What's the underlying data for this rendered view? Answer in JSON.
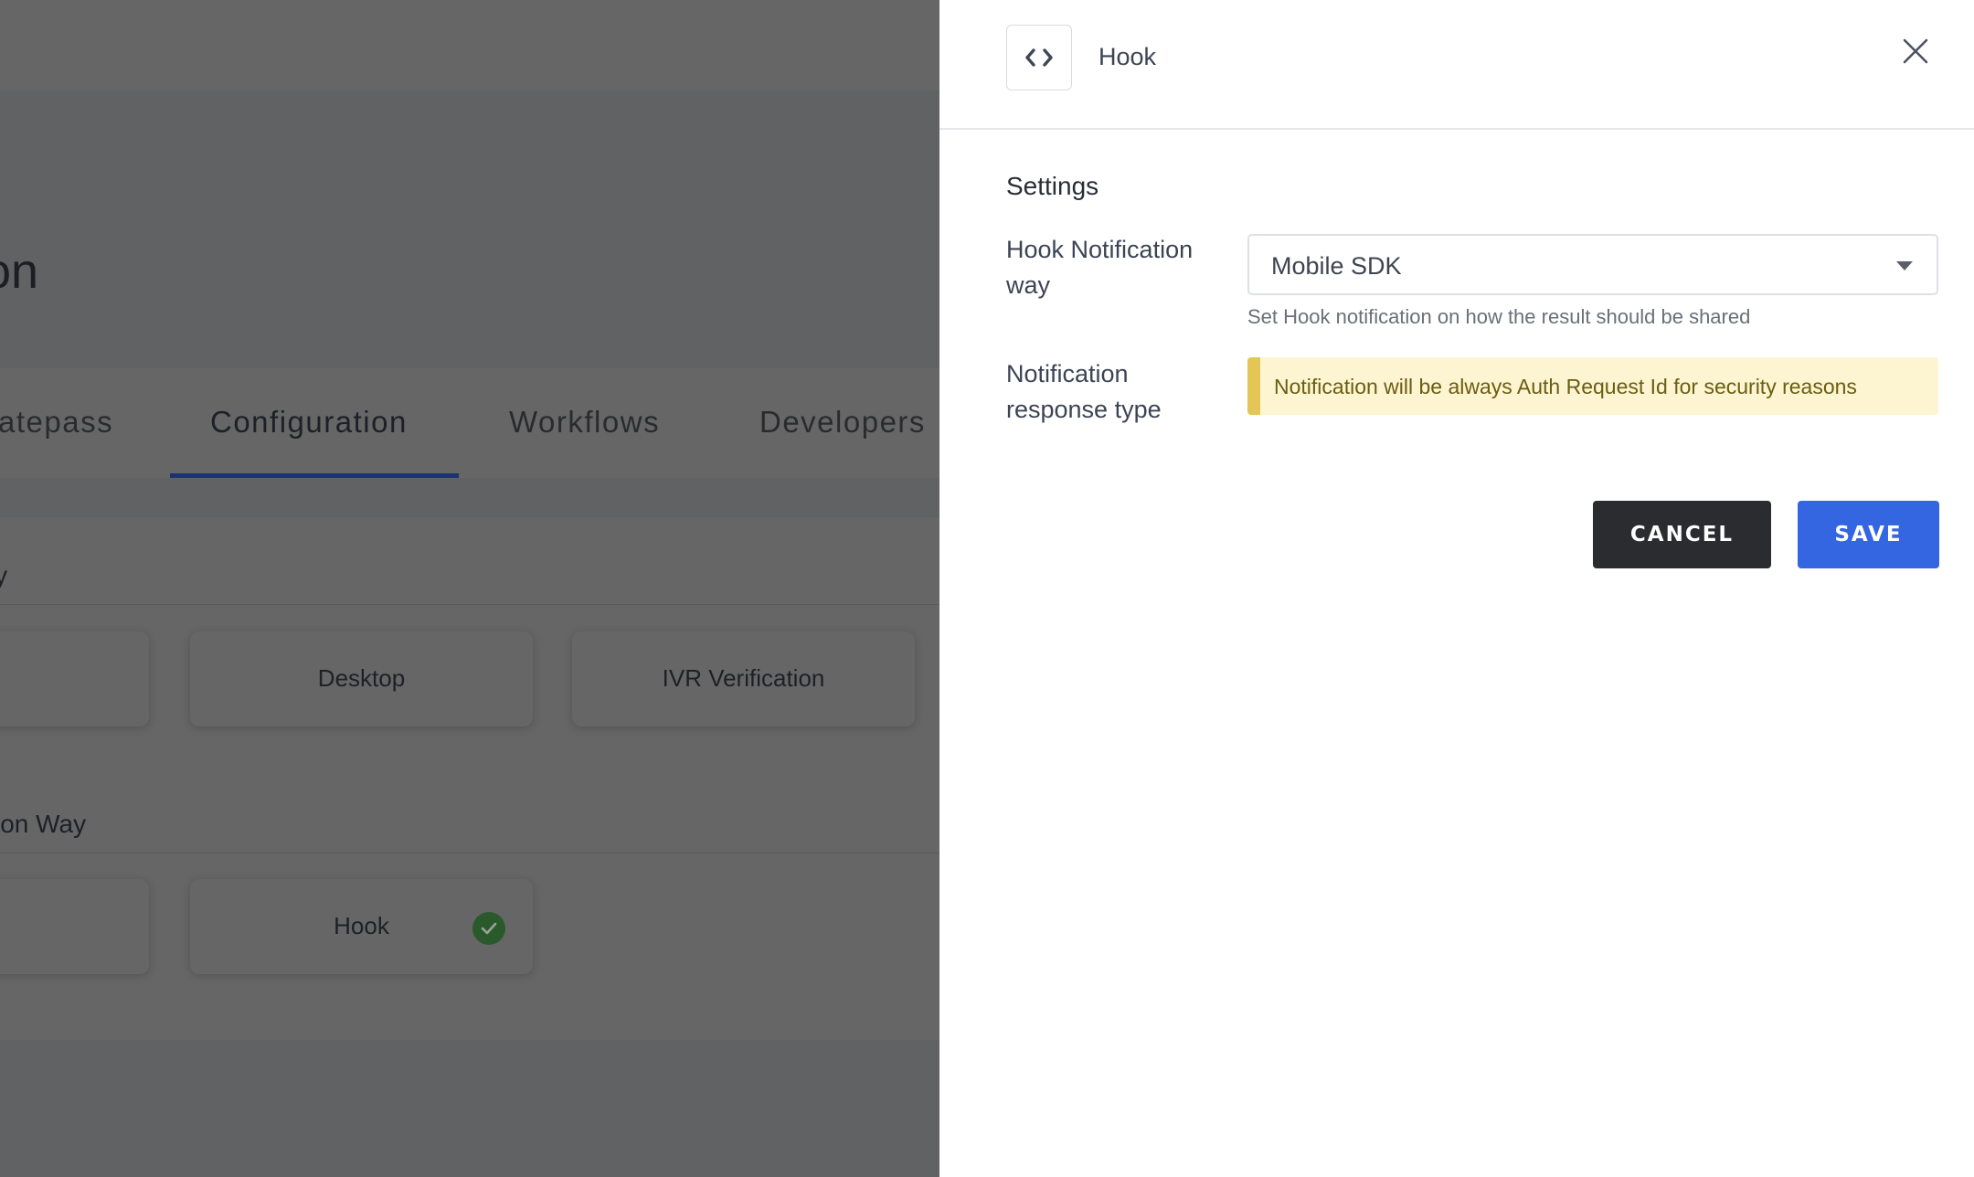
{
  "background_page": {
    "title_fragment": "on",
    "tabs": [
      {
        "label": "atepass",
        "active": false
      },
      {
        "label": "Configuration",
        "active": true
      },
      {
        "label": "Workflows",
        "active": false
      },
      {
        "label": "Developers",
        "active": false
      }
    ],
    "sections": [
      {
        "label_fragment": "y",
        "cards": [
          {
            "label": ""
          },
          {
            "label": "Desktop"
          },
          {
            "label": "IVR Verification"
          }
        ]
      },
      {
        "label_fragment": "ion Way",
        "cards": [
          {
            "label": ""
          },
          {
            "label": "Hook",
            "selected": true
          }
        ]
      }
    ]
  },
  "drawer": {
    "icon": "code-icon",
    "title": "Hook",
    "close_icon": "close-icon",
    "settings_title": "Settings",
    "fields": {
      "hook_notification_way": {
        "label": "Hook Notification way",
        "value": "Mobile SDK",
        "helper": "Set Hook notification on how the result should be shared"
      },
      "notification_response_type": {
        "label": "Notification response type",
        "notice": "Notification will be always Auth Request Id for security reasons"
      }
    },
    "buttons": {
      "cancel": "CANCEL",
      "save": "SAVE"
    }
  },
  "colors": {
    "primary": "#3366e0",
    "cancel": "#2b2c2f",
    "notice_bg": "#fdf5d2",
    "notice_accent": "#e3c655",
    "success": "#2a5a2c",
    "tab_underline": "#1d3270"
  }
}
